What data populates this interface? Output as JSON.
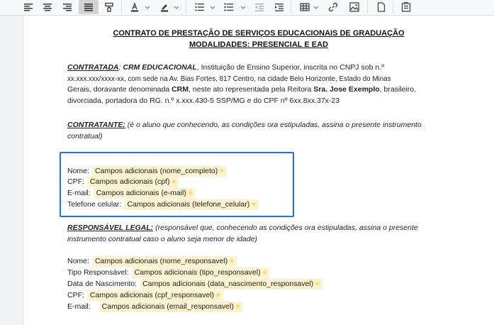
{
  "toolbar": {
    "icons": [
      "align-left-icon",
      "align-center-icon",
      "align-right-icon",
      "align-justify-icon",
      "format-paint-icon",
      "text-color-icon",
      "highlight-color-icon",
      "numbered-list-icon",
      "bulleted-list-icon",
      "outdent-icon",
      "indent-icon",
      "table-icon",
      "link-icon",
      "image-icon",
      "page-icon",
      "template-icon"
    ]
  },
  "document": {
    "title_line1": "CONTRATO DE PRESTAÇÃO DE SERVIÇOS EDUCACIONAIS DE GRADUAÇÃO",
    "title_line2": "MODALIDADES: PRESENCIAL E EAD",
    "contratada": {
      "label": "CONTRATADA",
      "name": "CRM EDUCACIONAL",
      "line1": ", Instituição de Ensino Superior, inscrita no CNPJ sob n.º",
      "line2": "xx.xxx.xxx/xxxx-xx, com sede na Av. Bias Fortes, 817 Centro, na cidade Belo Horizonte, Estado do Minas",
      "line3a": "Gerais, doravante denominada ",
      "crm": "CRM",
      "line3b": ", neste ato representada pela Reitora ",
      "reitora": "Sra. Jose Exemplo",
      "line3c": ", brasileiro,",
      "line4": "divorciada, portadora do RG. n.º x.xxx.430-5 SSP/MG e do CPF nº 6xx.8xx.37x-23"
    },
    "contratante": {
      "label": "CONTRATANTE:",
      "note_line1": " (é o aluno que conhecendo, as condições ora estipuladas, assina o presente instrumento",
      "note_line2": "contratual)"
    },
    "contratante_fields": [
      {
        "label": "Nome:",
        "chip": "Campos adicionais (nome_completo)"
      },
      {
        "label": "CPF:",
        "chip": "Campos adicionais (cpf)"
      },
      {
        "label": "E-mail:",
        "chip": "Campos adicionais (e-mail)"
      },
      {
        "label": "Telefone celular:",
        "chip": "Campos adicionais (telefone_celular)"
      }
    ],
    "responsavel": {
      "label": "RESPONSÁVEL LEGAL:",
      "note_line1": " (responsável que, conhecendo as condições ora estipuladas, assina o presente",
      "note_line2": "instrumento contratual caso o aluno seja menor de idade)"
    },
    "responsavel_fields": [
      {
        "label": "Nome:",
        "chip": "Campos adicionais (nome_responsavel)"
      },
      {
        "label": "Tipo Responsável:",
        "chip": "Campos adicionais (tipo_responsavel)"
      },
      {
        "label": "Data de Nascimento:",
        "chip": "Campos adicionais (data_nascimento_responsavel)"
      },
      {
        "label": "CPF:",
        "chip": "Campos adicionais (cpf_responsavel)"
      },
      {
        "label": "E-mail:",
        "chip": "Campos adicionais (email_responsavel)"
      }
    ],
    "chip_star": "✳"
  },
  "colors": {
    "focus": "#1a73e8",
    "chip_bg": "#fdf3cf",
    "star": "#f4c430"
  }
}
